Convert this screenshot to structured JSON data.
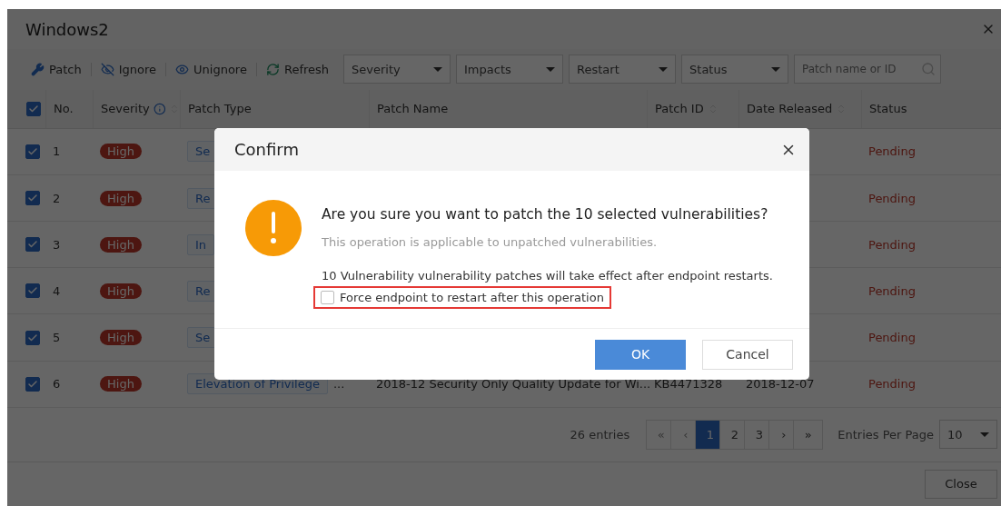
{
  "window": {
    "title": "Windows2"
  },
  "toolbar": {
    "actions": [
      {
        "label": "Patch",
        "kind": "patch"
      },
      {
        "label": "Ignore",
        "kind": "ignore"
      },
      {
        "label": "Unignore",
        "kind": "unignore"
      },
      {
        "label": "Refresh",
        "kind": "refresh"
      }
    ],
    "filters": [
      "Severity",
      "Impacts",
      "Restart",
      "Status"
    ],
    "search": {
      "placeholder": "Patch name or ID"
    }
  },
  "table": {
    "select_all": {
      "checked": true
    },
    "columns": [
      "No.",
      "Severity",
      "Patch Type",
      "Patch Name",
      "Patch ID",
      "Date Released",
      "Status"
    ],
    "rows": [
      {
        "checked": true,
        "no": "1",
        "severity": "High",
        "patch_type": "Se",
        "status": "Pending"
      },
      {
        "checked": true,
        "no": "2",
        "severity": "High",
        "patch_type": "Re",
        "status": "Pending"
      },
      {
        "checked": true,
        "no": "3",
        "severity": "High",
        "patch_type": "In",
        "status": "Pending"
      },
      {
        "checked": true,
        "no": "4",
        "severity": "High",
        "patch_type": "Re",
        "status": "Pending"
      },
      {
        "checked": true,
        "no": "5",
        "severity": "High",
        "patch_type": "Se",
        "status": "Pending"
      },
      {
        "checked": true,
        "no": "6",
        "severity": "High",
        "patch_type": "Elevation of Privilege",
        "more": "...",
        "patch_name": "2018-12 Security Only Quality Update for Wi...",
        "patch_id": "KB4471328",
        "date_released": "2018-12-07",
        "status": "Pending"
      }
    ]
  },
  "pagination": {
    "total": "26 entries",
    "pages": [
      {
        "label": "«",
        "selected": false,
        "disabled": true
      },
      {
        "label": "‹",
        "selected": false,
        "disabled": true
      },
      {
        "label": "1",
        "selected": true,
        "disabled": false
      },
      {
        "label": "2",
        "selected": false,
        "disabled": false
      },
      {
        "label": "3",
        "selected": false,
        "disabled": false
      },
      {
        "label": "›",
        "selected": false,
        "disabled": false
      },
      {
        "label": "»",
        "selected": false,
        "disabled": false
      }
    ],
    "per_page_label": "Entries Per Page",
    "per_page": "10"
  },
  "footer": {
    "button": "Close"
  },
  "dialog": {
    "title": "Confirm",
    "question": "Are you sure you want to patch the 10 selected vulnerabilities?",
    "note": "This operation is applicable to unpatched vulnerabilities.",
    "info": "10 Vulnerability vulnerability patches will take effect after endpoint restarts.",
    "force_restart": {
      "label": "Force endpoint to restart after this operation",
      "checked": false
    },
    "buttons": [
      {
        "label": "OK",
        "kind": "primary"
      },
      {
        "label": "Cancel",
        "kind": "secondary"
      }
    ]
  }
}
